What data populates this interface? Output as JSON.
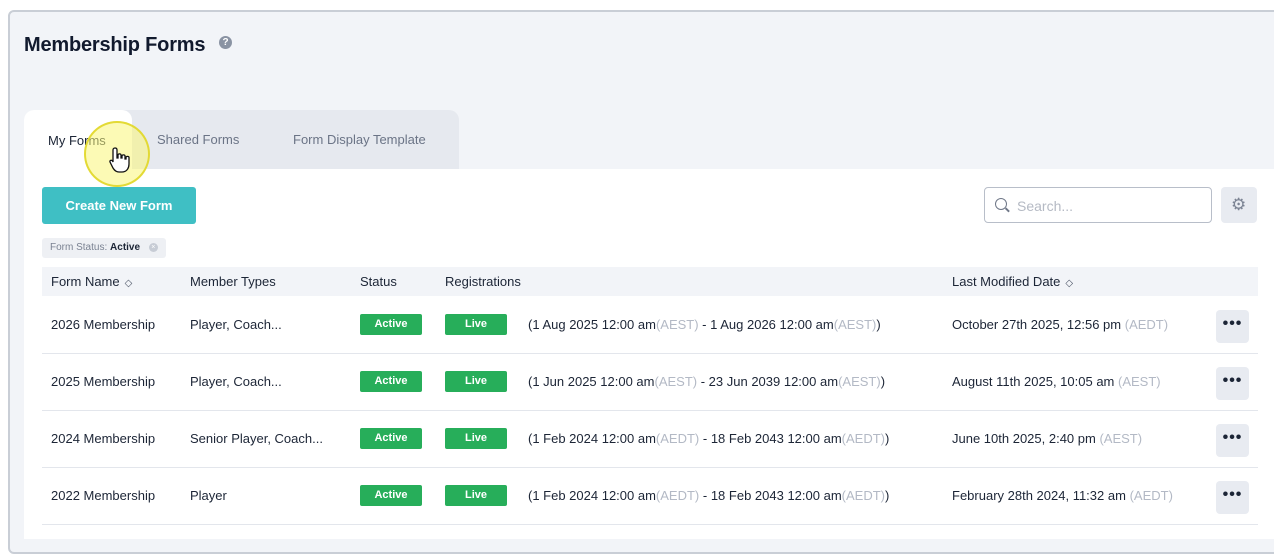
{
  "page": {
    "title": "Membership Forms"
  },
  "tabs": [
    {
      "label": "My Forms"
    },
    {
      "label": "Shared Forms"
    },
    {
      "label": "Form Display Template"
    }
  ],
  "toolbar": {
    "create_label": "Create New Form",
    "search_placeholder": "Search..."
  },
  "filter": {
    "label": "Form Status:",
    "value": "Active"
  },
  "table": {
    "columns": {
      "form_name": "Form Name",
      "member_types": "Member Types",
      "status": "Status",
      "registrations": "Registrations",
      "last_modified": "Last Modified Date"
    },
    "rows": [
      {
        "name": "2026 Membership",
        "member_types": "Player, Coach...",
        "status": "Active",
        "registration": "Live",
        "start": "(1 Aug 2025 12:00 am",
        "start_tz": "(AEST)",
        "sep": " - ",
        "end": "1 Aug 2026 12:00 am",
        "end_tz": "(AEST)",
        "close": ")",
        "modified": "October 27th 2025, 12:56 pm",
        "modified_tz": "(AEDT)"
      },
      {
        "name": "2025 Membership",
        "member_types": "Player, Coach...",
        "status": "Active",
        "registration": "Live",
        "start": "(1 Jun 2025 12:00 am",
        "start_tz": "(AEST)",
        "sep": " - ",
        "end": "23 Jun 2039 12:00 am",
        "end_tz": "(AEST)",
        "close": ")",
        "modified": "August 11th 2025, 10:05 am",
        "modified_tz": "(AEST)"
      },
      {
        "name": "2024 Membership",
        "member_types": "Senior Player, Coach...",
        "status": "Active",
        "registration": "Live",
        "start": "(1 Feb 2024 12:00 am",
        "start_tz": "(AEDT)",
        "sep": " - ",
        "end": "18 Feb 2043 12:00 am",
        "end_tz": "(AEDT)",
        "close": ")",
        "modified": "June 10th 2025, 2:40 pm",
        "modified_tz": "(AEST)"
      },
      {
        "name": "2022 Membership",
        "member_types": "Player",
        "status": "Active",
        "registration": "Live",
        "start": "(1 Feb 2024 12:00 am",
        "start_tz": "(AEDT)",
        "sep": " - ",
        "end": "18 Feb 2043 12:00 am",
        "end_tz": "(AEDT)",
        "close": ")",
        "modified": "February 28th 2024, 11:32 am",
        "modified_tz": "(AEDT)"
      }
    ]
  },
  "colors": {
    "accent": "#3fbfc4",
    "status_green": "#27ae5a"
  }
}
